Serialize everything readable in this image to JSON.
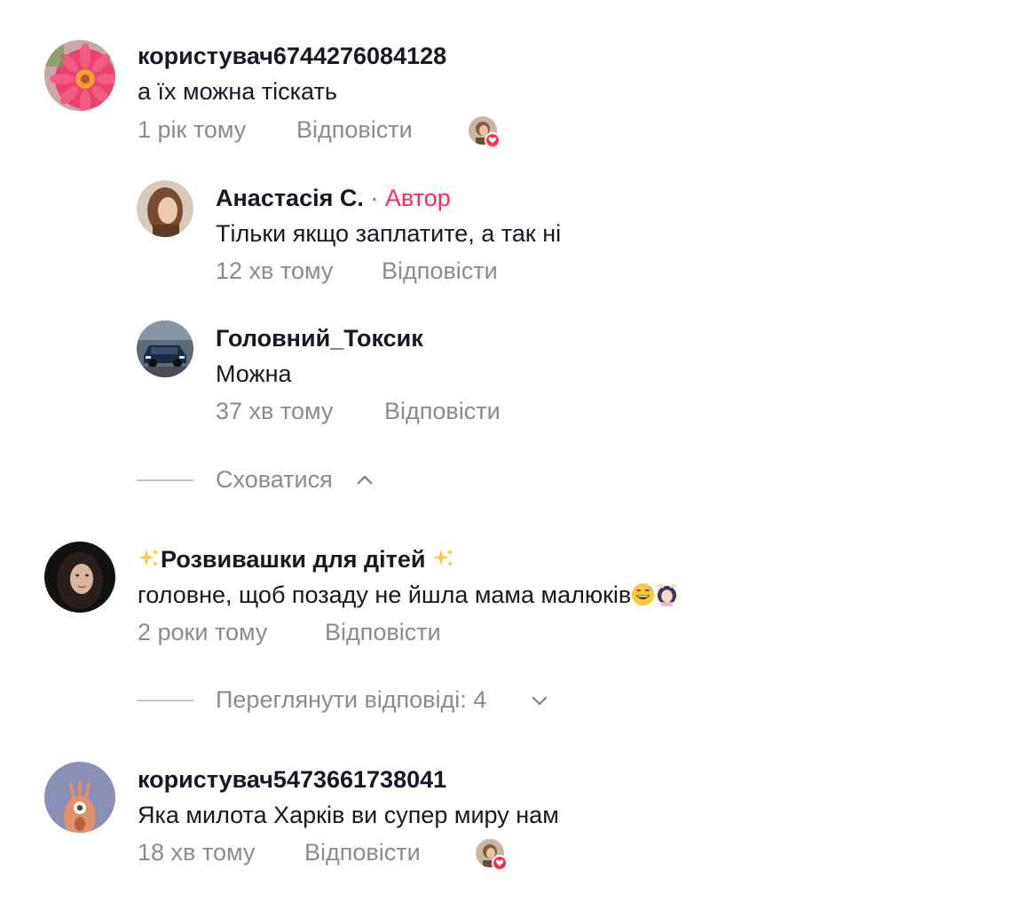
{
  "comments": [
    {
      "username": "користувач6744276084128",
      "text": "а їх можна тіскать",
      "time": "1 рік тому",
      "reply_label": "Відповісти",
      "liked_by_author": true,
      "avatar": "pink-flower"
    },
    {
      "username": "",
      "username_core": "Розвивашки для дітей",
      "text": "головне, щоб позаду не йшла мама малюків",
      "time": "2 роки тому",
      "reply_label": "Відповісти",
      "avatar": "girl-dark"
    },
    {
      "username": "користувач5473661738041",
      "text": "Яка милота Харків ви супер миру нам",
      "time": "18 хв тому",
      "reply_label": "Відповісти",
      "liked_by_author": true,
      "avatar": "default-character"
    }
  ],
  "replies": [
    {
      "username": "Анастасія С.",
      "author_badge": " · Автор",
      "text": "Тільки якщо заплатите, а так ні",
      "time": "12 хв тому",
      "reply_label": "Відповісти",
      "avatar": "woman-portrait"
    },
    {
      "username": "Головний_Токсик",
      "text": "Можна",
      "time": "37 хв тому",
      "reply_label": "Відповісти",
      "avatar": "car"
    }
  ],
  "toggles": {
    "hide_label": "Сховатися",
    "view_replies_label": "Переглянути відповіді: 4"
  },
  "icons": {
    "emoji_1": "grinning-sweat-emoji",
    "emoji_2": "woman-gesturing-ok-emoji",
    "sparkles": "sparkles-emoji",
    "heart": "heart-icon",
    "chevron_up": "chevron-up-icon",
    "chevron_down": "chevron-down-icon"
  },
  "colors": {
    "author_accent": "#fe2c55",
    "secondary_text": "#8a8b91",
    "primary_text": "#161823"
  }
}
